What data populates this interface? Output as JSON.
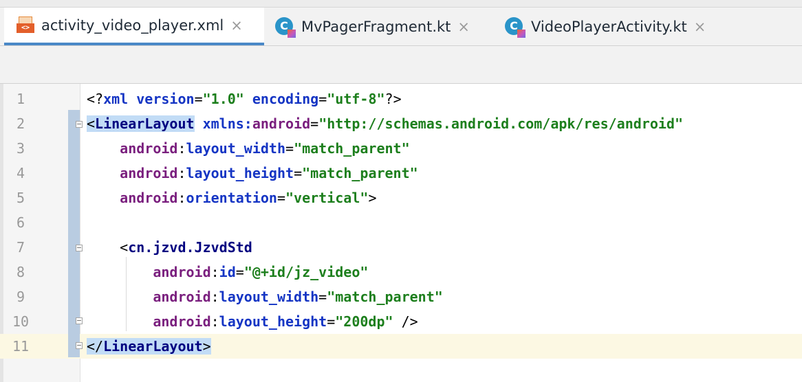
{
  "tabs": [
    {
      "label": "activity_video_player.xml",
      "icon": "xml-file-icon",
      "active": true
    },
    {
      "label": "MvPagerFragment.kt",
      "icon": "kotlin-class-icon",
      "active": false
    },
    {
      "label": "VideoPlayerActivity.kt",
      "icon": "kotlin-class-icon",
      "active": false
    }
  ],
  "close_glyph": "×",
  "xml_icon_text": "<>",
  "kt_icon_text": "C",
  "editor": {
    "current_line": 11,
    "lines": [
      {
        "num": "1",
        "parts": [
          [
            "punct",
            "<?"
          ],
          [
            "xmlkw",
            "xml"
          ],
          [
            "punct",
            " "
          ],
          [
            "attr",
            "version"
          ],
          [
            "punct",
            "="
          ],
          [
            "val",
            "\"1.0\""
          ],
          [
            "punct",
            " "
          ],
          [
            "attr",
            "encoding"
          ],
          [
            "punct",
            "="
          ],
          [
            "val",
            "\"utf-8\""
          ],
          [
            "punct",
            "?>"
          ]
        ]
      },
      {
        "num": "2",
        "parts": [
          [
            "punct hl",
            "<"
          ],
          [
            "tag hl",
            "LinearLayout"
          ],
          [
            "punct",
            " "
          ],
          [
            "attr",
            "xmlns:"
          ],
          [
            "ns",
            "android"
          ],
          [
            "punct",
            "="
          ],
          [
            "val",
            "\"http://schemas.android.com/apk/res/android\""
          ]
        ]
      },
      {
        "num": "3",
        "parts": [
          [
            "punct",
            "    "
          ],
          [
            "ns",
            "android"
          ],
          [
            "punct",
            ":"
          ],
          [
            "attr",
            "layout_width"
          ],
          [
            "punct",
            "="
          ],
          [
            "val",
            "\"match_parent\""
          ]
        ]
      },
      {
        "num": "4",
        "parts": [
          [
            "punct",
            "    "
          ],
          [
            "ns",
            "android"
          ],
          [
            "punct",
            ":"
          ],
          [
            "attr",
            "layout_height"
          ],
          [
            "punct",
            "="
          ],
          [
            "val",
            "\"match_parent\""
          ]
        ]
      },
      {
        "num": "5",
        "parts": [
          [
            "punct",
            "    "
          ],
          [
            "ns",
            "android"
          ],
          [
            "punct",
            ":"
          ],
          [
            "attr",
            "orientation"
          ],
          [
            "punct",
            "="
          ],
          [
            "val",
            "\"vertical\""
          ],
          [
            "punct",
            ">"
          ]
        ]
      },
      {
        "num": "6",
        "parts": []
      },
      {
        "num": "7",
        "parts": [
          [
            "punct",
            "    <"
          ],
          [
            "jz",
            "cn.jzvd.JzvdStd"
          ]
        ]
      },
      {
        "num": "8",
        "parts": [
          [
            "punct",
            "        "
          ],
          [
            "ns",
            "android"
          ],
          [
            "punct",
            ":"
          ],
          [
            "attr",
            "id"
          ],
          [
            "punct",
            "="
          ],
          [
            "val",
            "\"@+id/jz_video\""
          ]
        ]
      },
      {
        "num": "9",
        "parts": [
          [
            "punct",
            "        "
          ],
          [
            "ns",
            "android"
          ],
          [
            "punct",
            ":"
          ],
          [
            "attr",
            "layout_width"
          ],
          [
            "punct",
            "="
          ],
          [
            "val",
            "\"match_parent\""
          ]
        ]
      },
      {
        "num": "10",
        "parts": [
          [
            "punct",
            "        "
          ],
          [
            "ns",
            "android"
          ],
          [
            "punct",
            ":"
          ],
          [
            "attr",
            "layout_height"
          ],
          [
            "punct",
            "="
          ],
          [
            "val",
            "\"200dp\""
          ],
          [
            "punct",
            " />"
          ]
        ]
      },
      {
        "num": "11",
        "parts": [
          [
            "punct hl",
            "</"
          ],
          [
            "tag hl",
            "LinearLayout"
          ],
          [
            "punct hl",
            ">"
          ]
        ]
      }
    ]
  },
  "colors": {
    "active_tab_underline": "#4a88c7",
    "current_line_bg": "#fcf8e3",
    "tag_highlight": "#c2dcf6"
  }
}
